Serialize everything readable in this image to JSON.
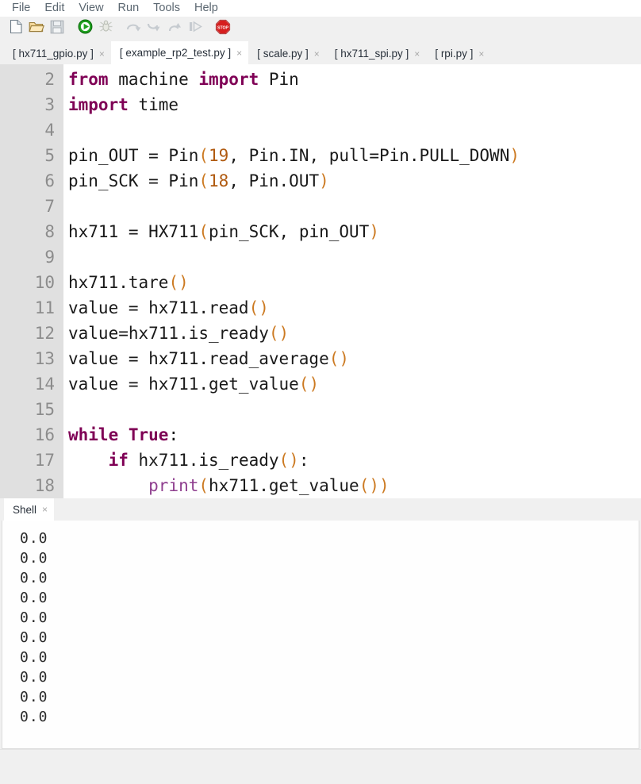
{
  "menu": {
    "items": [
      {
        "label": "File",
        "name": "menu-file"
      },
      {
        "label": "Edit",
        "name": "menu-edit"
      },
      {
        "label": "View",
        "name": "menu-view"
      },
      {
        "label": "Run",
        "name": "menu-run"
      },
      {
        "label": "Tools",
        "name": "menu-tools"
      },
      {
        "label": "Help",
        "name": "menu-help"
      }
    ]
  },
  "toolbar": {
    "buttons": [
      {
        "icon": "new-file-icon",
        "enabled": true
      },
      {
        "icon": "open-folder-icon",
        "enabled": true
      },
      {
        "icon": "save-icon",
        "enabled": false
      },
      {
        "icon": "run-icon",
        "enabled": true
      },
      {
        "icon": "debug-bug-icon",
        "enabled": false
      },
      {
        "icon": "step-over-icon",
        "enabled": false
      },
      {
        "icon": "step-into-icon",
        "enabled": false
      },
      {
        "icon": "step-out-icon",
        "enabled": false
      },
      {
        "icon": "resume-icon",
        "enabled": false
      },
      {
        "icon": "stop-icon",
        "enabled": true
      }
    ]
  },
  "tabs": {
    "close_glyph": "×",
    "items": [
      {
        "label": "[ hx711_gpio.py ]",
        "active": false
      },
      {
        "label": "[ example_rp2_test.py ]",
        "active": true
      },
      {
        "label": "[ scale.py ]",
        "active": false
      },
      {
        "label": "[ hx711_spi.py ]",
        "active": false
      },
      {
        "label": "[ rpi.py ]",
        "active": false
      }
    ]
  },
  "editor": {
    "first_line_number": 2,
    "lines": [
      {
        "n": 2,
        "tokens": [
          {
            "t": "from",
            "c": "kw"
          },
          {
            "t": " machine ",
            "c": ""
          },
          {
            "t": "import",
            "c": "kw"
          },
          {
            "t": " Pin",
            "c": ""
          }
        ]
      },
      {
        "n": 3,
        "tokens": [
          {
            "t": "import",
            "c": "kw"
          },
          {
            "t": " time",
            "c": ""
          }
        ]
      },
      {
        "n": 4,
        "tokens": [
          {
            "t": "",
            "c": ""
          }
        ]
      },
      {
        "n": 5,
        "tokens": [
          {
            "t": "pin_OUT = Pin",
            "c": ""
          },
          {
            "t": "(",
            "c": "pun"
          },
          {
            "t": "19",
            "c": "num"
          },
          {
            "t": ", Pin.IN, pull=Pin.PULL_DOWN",
            "c": ""
          },
          {
            "t": ")",
            "c": "pun"
          }
        ]
      },
      {
        "n": 6,
        "tokens": [
          {
            "t": "pin_SCK = Pin",
            "c": ""
          },
          {
            "t": "(",
            "c": "pun"
          },
          {
            "t": "18",
            "c": "num"
          },
          {
            "t": ", Pin.OUT",
            "c": ""
          },
          {
            "t": ")",
            "c": "pun"
          }
        ]
      },
      {
        "n": 7,
        "tokens": [
          {
            "t": "",
            "c": ""
          }
        ]
      },
      {
        "n": 8,
        "tokens": [
          {
            "t": "hx711 = HX711",
            "c": ""
          },
          {
            "t": "(",
            "c": "pun"
          },
          {
            "t": "pin_SCK, pin_OUT",
            "c": ""
          },
          {
            "t": ")",
            "c": "pun"
          }
        ]
      },
      {
        "n": 9,
        "tokens": [
          {
            "t": "",
            "c": ""
          }
        ]
      },
      {
        "n": 10,
        "tokens": [
          {
            "t": "hx711.tare",
            "c": ""
          },
          {
            "t": "()",
            "c": "pun"
          }
        ]
      },
      {
        "n": 11,
        "tokens": [
          {
            "t": "value = hx711.read",
            "c": ""
          },
          {
            "t": "()",
            "c": "pun"
          }
        ]
      },
      {
        "n": 12,
        "tokens": [
          {
            "t": "value=hx711.is_ready",
            "c": ""
          },
          {
            "t": "()",
            "c": "pun"
          }
        ]
      },
      {
        "n": 13,
        "tokens": [
          {
            "t": "value = hx711.read_average",
            "c": ""
          },
          {
            "t": "()",
            "c": "pun"
          }
        ]
      },
      {
        "n": 14,
        "tokens": [
          {
            "t": "value = hx711.get_value",
            "c": ""
          },
          {
            "t": "()",
            "c": "pun"
          }
        ]
      },
      {
        "n": 15,
        "tokens": [
          {
            "t": "",
            "c": ""
          }
        ]
      },
      {
        "n": 16,
        "tokens": [
          {
            "t": "while",
            "c": "kw"
          },
          {
            "t": " ",
            "c": ""
          },
          {
            "t": "True",
            "c": "kw"
          },
          {
            "t": ":",
            "c": ""
          }
        ]
      },
      {
        "n": 17,
        "tokens": [
          {
            "t": "    ",
            "c": ""
          },
          {
            "t": "if",
            "c": "kw"
          },
          {
            "t": " hx711.is_ready",
            "c": ""
          },
          {
            "t": "()",
            "c": "pun"
          },
          {
            "t": ":",
            "c": ""
          }
        ]
      },
      {
        "n": 18,
        "tokens": [
          {
            "t": "        ",
            "c": ""
          },
          {
            "t": "print",
            "c": "bi"
          },
          {
            "t": "(",
            "c": "pun"
          },
          {
            "t": "hx711.get_value",
            "c": ""
          },
          {
            "t": "())",
            "c": "pun"
          }
        ]
      }
    ]
  },
  "shell": {
    "tab_label": "Shell",
    "close_glyph": "×",
    "output": [
      "0.0",
      "0.0",
      "0.0",
      "0.0",
      "0.0",
      "0.0",
      "0.0",
      "0.0",
      "0.0",
      "0.0"
    ]
  },
  "colors": {
    "keyword": "#7f0055",
    "builtin": "#8f3f8f",
    "number": "#b05a10",
    "punct": "#cc7a22",
    "menu_text": "#5a6670",
    "gutter_bg": "#e0e0e0",
    "gutter_text": "#8c8c8c",
    "chrome_bg": "#f0f0f0",
    "run_green": "#17a117",
    "stop_red": "#d61f1f"
  }
}
